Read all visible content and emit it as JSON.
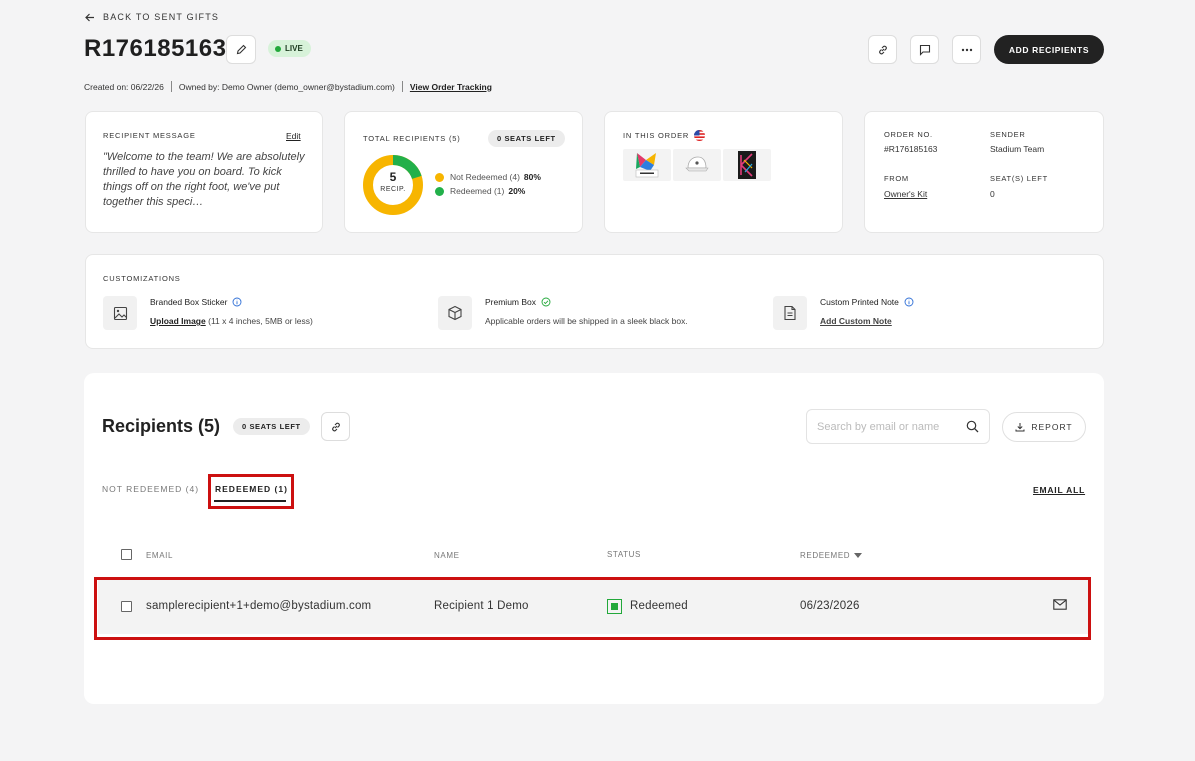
{
  "header": {
    "back_label": "BACK TO SENT GIFTS",
    "order_id": "R176185163",
    "status_badge": "LIVE",
    "created_on": "Created on: 06/22/26",
    "owned_by": "Owned by: Demo Owner (demo_owner@bystadium.com)",
    "view_tracking": "View Order Tracking",
    "add_recipients": "ADD RECIPIENTS"
  },
  "message_card": {
    "label": "RECIPIENT MESSAGE",
    "edit": "Edit",
    "text": "\"Welcome to the team! We are absolutely thrilled to have you on board. To kick things off on the right foot, we've put together this speci…"
  },
  "totals_card": {
    "label": "TOTAL RECIPIENTS (5)",
    "seats_left": "0 SEATS LEFT",
    "donut_count": "5",
    "donut_unit": "RECIP.",
    "legend": [
      {
        "label": "Not Redeemed (4)",
        "pct": "80%",
        "color": "#f7b500",
        "value": 80
      },
      {
        "label": "Redeemed (1)",
        "pct": "20%",
        "color": "#22b04a",
        "value": 20
      }
    ]
  },
  "order_card": {
    "label": "IN THIS ORDER",
    "flag_icon": "us-flag-icon",
    "items": [
      "product-box-thumb",
      "cap-thumb",
      "notebook-thumb"
    ]
  },
  "details_card": {
    "order_no_label": "ORDER NO.",
    "order_no_value": "#R176185163",
    "sender_label": "SENDER",
    "sender_value": "Stadium Team",
    "from_label": "FROM",
    "from_value": "Owner's Kit",
    "seats_label": "SEAT(S) LEFT",
    "seats_value": "0"
  },
  "customizations": {
    "label": "CUSTOMIZATIONS",
    "items": [
      {
        "title": "Branded Box Sticker",
        "link": "Upload Image",
        "sub": "(11 x 4 inches, 5MB or less)"
      },
      {
        "title": "Premium Box",
        "sub": "Applicable orders will be shipped in a sleek black box."
      },
      {
        "title": "Custom Printed Note",
        "link": "Add Custom Note"
      }
    ]
  },
  "recipients": {
    "title": "Recipients (5)",
    "seats_left": "0 SEATS LEFT",
    "search_placeholder": "Search by email or name",
    "report": "REPORT",
    "tabs": [
      "NOT REDEEMED (4)",
      "REDEEMED (1)"
    ],
    "email_all": "EMAIL ALL",
    "columns": [
      "EMAIL",
      "NAME",
      "STATUS",
      "REDEEMED"
    ],
    "rows": [
      {
        "email": "samplerecipient+1+demo@bystadium.com",
        "name": "Recipient 1 Demo",
        "status": "Redeemed",
        "redeemed": "06/23/2026"
      }
    ]
  },
  "colors": {
    "accent_dark": "#222222",
    "live_bg": "#d7f2d9",
    "highlight": "#cc1010",
    "pending": "#f7b500",
    "redeemed": "#22b04a"
  }
}
